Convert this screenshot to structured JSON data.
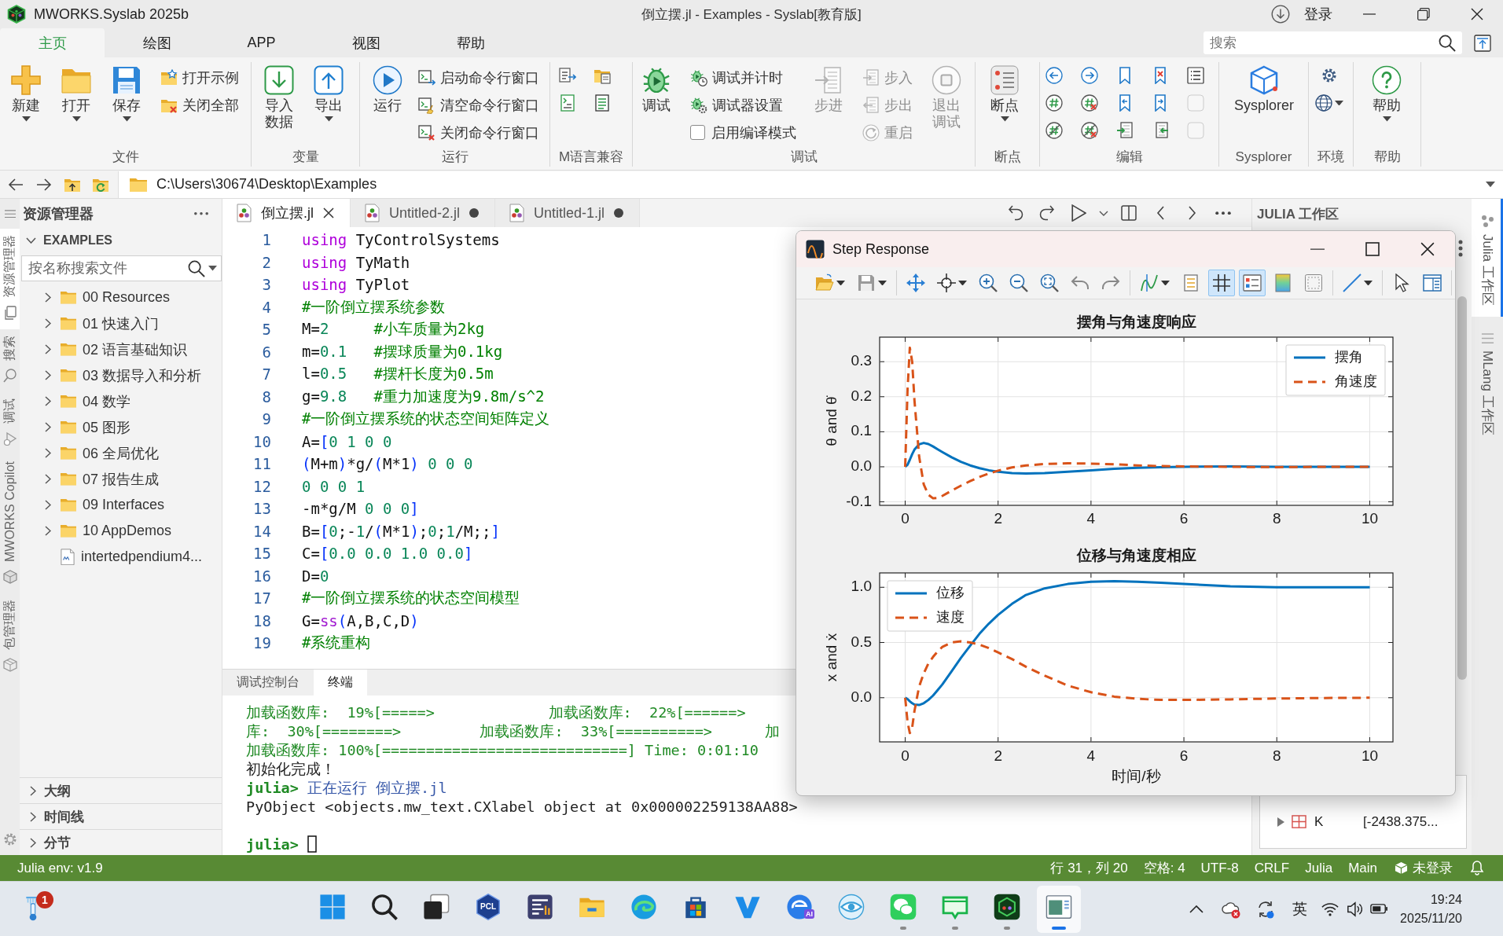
{
  "title_bar": {
    "app_name": "MWORKS.Syslab 2025b",
    "title": "倒立摆.jl - Examples - Syslab[教育版]",
    "login": "登录"
  },
  "ribbon": {
    "tabs": [
      {
        "label": "主页",
        "selected": true
      },
      {
        "label": "绘图",
        "selected": false
      },
      {
        "label": "APP",
        "selected": false
      },
      {
        "label": "视图",
        "selected": false
      },
      {
        "label": "帮助",
        "selected": false
      }
    ],
    "search": {
      "placeholder": "搜索"
    },
    "groups": [
      {
        "columns": [
          {
            "kind": "large",
            "label": "新建",
            "dropdown": true,
            "disabled": false
          },
          {
            "kind": "large",
            "label": "打开",
            "dropdown": true,
            "disabled": false
          },
          {
            "kind": "large",
            "label": "保存",
            "dropdown": true,
            "disabled": false
          },
          {
            "kind": "stack",
            "items": [
              {
                "kind": "button",
                "label": "打开示例",
                "disabled": false
              },
              {
                "kind": "button",
                "label": "关闭全部",
                "disabled": false
              }
            ]
          }
        ],
        "label": "文件"
      },
      {
        "columns": [
          {
            "kind": "large",
            "label": "导入数据",
            "dropdown": false,
            "disabled": false
          },
          {
            "kind": "large",
            "label": "导出",
            "dropdown": true,
            "disabled": false
          }
        ],
        "label": "变量"
      },
      {
        "columns": [
          {
            "kind": "large",
            "label": "运行",
            "dropdown": false,
            "disabled": false
          },
          {
            "kind": "stack",
            "items": [
              {
                "kind": "button",
                "label": "启动命令行窗口",
                "disabled": false
              },
              {
                "kind": "button",
                "label": "清空命令行窗口",
                "disabled": false
              },
              {
                "kind": "button",
                "label": "关闭命令行窗口",
                "disabled": false
              }
            ]
          }
        ],
        "label": "运行"
      },
      {
        "columns": [
          {
            "kind": "icons",
            "items": [
              {
                "disabled": false
              },
              {
                "disabled": false
              }
            ]
          },
          {
            "kind": "icons",
            "items": [
              {
                "disabled": false
              },
              {
                "disabled": false
              }
            ]
          }
        ],
        "label": "M语言兼容"
      },
      {
        "columns": [
          {
            "kind": "large",
            "label": "调试",
            "dropdown": false,
            "disabled": false
          },
          {
            "kind": "stack",
            "items": [
              {
                "kind": "button",
                "label": "调试并计时",
                "disabled": false
              },
              {
                "kind": "button",
                "label": "调试器设置",
                "disabled": false
              },
              {
                "kind": "check",
                "label": "启用编译模式",
                "checked": false
              }
            ]
          },
          {
            "kind": "large",
            "label": "步进",
            "dropdown": false,
            "disabled": true
          },
          {
            "kind": "stack",
            "items": [
              {
                "kind": "button",
                "label": "步入",
                "disabled": true
              },
              {
                "kind": "button",
                "label": "步出",
                "disabled": true
              },
              {
                "kind": "button",
                "label": "重启",
                "disabled": true
              }
            ]
          },
          {
            "kind": "large",
            "label": "退出调试",
            "dropdown": false,
            "disabled": true
          }
        ],
        "label": "调试"
      },
      {
        "columns": [
          {
            "kind": "large",
            "label": "断点",
            "dropdown": true,
            "disabled": false
          }
        ],
        "label": "断点"
      },
      {
        "columns": [
          {
            "kind": "icons",
            "items": [
              {
                "disabled": false
              },
              {
                "disabled": false
              },
              {
                "disabled": false
              }
            ]
          },
          {
            "kind": "icons",
            "items": [
              {
                "disabled": false
              },
              {
                "disabled": false
              },
              {
                "disabled": false
              }
            ]
          },
          {
            "kind": "icons",
            "items": [
              {
                "disabled": false
              },
              {
                "disabled": false
              },
              {
                "disabled": false
              }
            ]
          },
          {
            "kind": "icons",
            "items": [
              {
                "disabled": false
              },
              {
                "disabled": false
              },
              {
                "disabled": false
              }
            ]
          },
          {
            "kind": "icons",
            "items": [
              {
                "disabled": false
              },
              {
                "disabled": true
              },
              {
                "disabled": true
              }
            ]
          }
        ],
        "label": "编辑"
      },
      {
        "columns": [
          {
            "kind": "large",
            "label": "Sysplorer",
            "dropdown": false,
            "disabled": false
          }
        ],
        "label": "Sysplorer"
      },
      {
        "columns": [
          {
            "kind": "icons",
            "items": [
              {
                "disabled": false,
                "dropdown": false
              },
              {
                "disabled": false,
                "dropdown": true
              }
            ]
          }
        ],
        "label": "环境"
      },
      {
        "columns": [
          {
            "kind": "large",
            "label": "帮助",
            "dropdown": true,
            "disabled": false
          }
        ],
        "label": "帮助"
      }
    ]
  },
  "address_bar": {
    "path": "C:\\Users\\30674\\Desktop\\Examples"
  },
  "activity_bar": [
    {
      "label": "资源管理器",
      "selected": true
    },
    {
      "label": "搜索",
      "selected": false
    },
    {
      "label": "调试",
      "selected": false
    },
    {
      "label": "MWORKS Copilot",
      "selected": false
    },
    {
      "label": "包管理器",
      "selected": false
    }
  ],
  "explorer": {
    "title": "资源管理器",
    "section": {
      "label": "EXAMPLES",
      "expanded": true
    },
    "search": {
      "placeholder": "按名称搜索文件"
    },
    "items": [
      {
        "kind": "folder",
        "label": "00 Resources",
        "expanded": false
      },
      {
        "kind": "folder",
        "label": "01 快速入门",
        "expanded": false
      },
      {
        "kind": "folder",
        "label": "02 语言基础知识",
        "expanded": false
      },
      {
        "kind": "folder",
        "label": "03 数据导入和分析",
        "expanded": false
      },
      {
        "kind": "folder",
        "label": "04 数学",
        "expanded": false
      },
      {
        "kind": "folder",
        "label": "05 图形",
        "expanded": false
      },
      {
        "kind": "folder",
        "label": "06 全局优化",
        "expanded": false
      },
      {
        "kind": "folder",
        "label": "07 报告生成",
        "expanded": false
      },
      {
        "kind": "folder",
        "label": "09 Interfaces",
        "expanded": false
      },
      {
        "kind": "folder",
        "label": "10 AppDemos",
        "expanded": false
      },
      {
        "kind": "file",
        "label": "intertedpendium4..."
      }
    ],
    "bottom_sections": [
      {
        "label": "大纲",
        "expanded": false
      },
      {
        "label": "时间线",
        "expanded": false
      },
      {
        "label": "分节",
        "expanded": false
      }
    ]
  },
  "editor": {
    "tabs": [
      {
        "label": "倒立摆.jl",
        "selected": true,
        "modified": false
      },
      {
        "label": "Untitled-2.jl",
        "selected": false,
        "modified": true
      },
      {
        "label": "Untitled-1.jl",
        "selected": false,
        "modified": true
      }
    ],
    "lines": [
      {
        "number": "1",
        "tokens": [
          {
            "kind": "keyword",
            "text": "using"
          },
          {
            "kind": "plain",
            "text": " TyControlSystems"
          }
        ]
      },
      {
        "number": "2",
        "tokens": [
          {
            "kind": "keyword",
            "text": "using"
          },
          {
            "kind": "plain",
            "text": " TyMath"
          }
        ]
      },
      {
        "number": "3",
        "tokens": [
          {
            "kind": "keyword",
            "text": "using"
          },
          {
            "kind": "plain",
            "text": " TyPlot"
          }
        ]
      },
      {
        "number": "4",
        "comment": "#一阶倒立摆系统参数"
      },
      {
        "number": "5",
        "tokens": [
          {
            "kind": "plain",
            "text": "M="
          },
          {
            "kind": "number",
            "text": "2"
          }
        ],
        "comment": "#小车质量为2kg"
      },
      {
        "number": "6",
        "tokens": [
          {
            "kind": "plain",
            "text": "m="
          },
          {
            "kind": "number",
            "text": "0.1"
          }
        ],
        "comment": "#摆球质量为0.1kg"
      },
      {
        "number": "7",
        "tokens": [
          {
            "kind": "plain",
            "text": "l="
          },
          {
            "kind": "number",
            "text": "0.5"
          }
        ],
        "comment": "#摆杆长度为0.5m"
      },
      {
        "number": "8",
        "tokens": [
          {
            "kind": "plain",
            "text": "g="
          },
          {
            "kind": "number",
            "text": "9.8"
          }
        ],
        "comment": "#重力加速度为9.8m/s^2"
      },
      {
        "number": "9",
        "comment": "#一阶倒立摆系统的状态空间矩阵定义"
      },
      {
        "number": "10",
        "tokens": [
          {
            "kind": "plain",
            "text": "A="
          },
          {
            "kind": "bracket",
            "text": "["
          },
          {
            "kind": "number",
            "text": "0 1 0 0"
          }
        ]
      },
      {
        "number": "11",
        "tokens": [
          {
            "kind": "bracket",
            "text": "("
          },
          {
            "kind": "plain",
            "text": "M+m"
          },
          {
            "kind": "bracket",
            "text": ")"
          },
          {
            "kind": "plain",
            "text": "*g/"
          },
          {
            "kind": "bracket",
            "text": "("
          },
          {
            "kind": "plain",
            "text": "M*1"
          },
          {
            "kind": "bracket",
            "text": ") "
          },
          {
            "kind": "number",
            "text": "0 0 0"
          }
        ]
      },
      {
        "number": "12",
        "tokens": [
          {
            "kind": "number",
            "text": "0 0 0 1"
          }
        ]
      },
      {
        "number": "13",
        "tokens": [
          {
            "kind": "plain",
            "text": "-m*g/M "
          },
          {
            "kind": "number",
            "text": "0 0 0"
          },
          {
            "kind": "bracket",
            "text": "]"
          }
        ]
      },
      {
        "number": "14",
        "tokens": [
          {
            "kind": "plain",
            "text": "B="
          },
          {
            "kind": "bracket",
            "text": "["
          },
          {
            "kind": "number",
            "text": "0"
          },
          {
            "kind": "plain",
            "text": ";-"
          },
          {
            "kind": "number",
            "text": "1"
          },
          {
            "kind": "plain",
            "text": "/"
          },
          {
            "kind": "bracket",
            "text": "("
          },
          {
            "kind": "plain",
            "text": "M*1"
          },
          {
            "kind": "bracket",
            "text": ")"
          },
          {
            "kind": "plain",
            "text": ";"
          },
          {
            "kind": "number",
            "text": "0"
          },
          {
            "kind": "plain",
            "text": ";"
          },
          {
            "kind": "number",
            "text": "1"
          },
          {
            "kind": "plain",
            "text": "/M;;"
          },
          {
            "kind": "bracket",
            "text": "]"
          }
        ]
      },
      {
        "number": "15",
        "tokens": [
          {
            "kind": "plain",
            "text": "C="
          },
          {
            "kind": "bracket",
            "text": "["
          },
          {
            "kind": "number",
            "text": "0.0 0.0 1.0 0.0"
          },
          {
            "kind": "bracket",
            "text": "]"
          }
        ]
      },
      {
        "number": "16",
        "tokens": [
          {
            "kind": "plain",
            "text": "D="
          },
          {
            "kind": "number",
            "text": "0"
          }
        ]
      },
      {
        "number": "17",
        "comment": "#一阶倒立摆系统的状态空间模型"
      },
      {
        "number": "18",
        "tokens": [
          {
            "kind": "plain",
            "text": "G="
          },
          {
            "kind": "call",
            "text": "ss"
          },
          {
            "kind": "bracket",
            "text": "("
          },
          {
            "kind": "plain",
            "text": "A,B,C,D"
          },
          {
            "kind": "bracket",
            "text": ")"
          }
        ]
      },
      {
        "number": "19",
        "comment": "#系统重构"
      }
    ]
  },
  "panel": {
    "tabs": [
      {
        "label": "调试控制台",
        "selected": false
      },
      {
        "label": "终端",
        "selected": true
      }
    ],
    "lines": [
      {
        "kind": "progress",
        "text": "加载函数库:  19%[=====>             加载函数库:  22%[======>"
      },
      {
        "kind": "progress",
        "text": "库:  30%[========>         加载函数库:  33%[==========>      加"
      },
      {
        "kind": "progress",
        "text": "加载函数库: 100%[============================] Time: 0:01:10"
      },
      {
        "kind": "output",
        "text": "初始化完成！"
      },
      {
        "kind": "prompt",
        "prompt": "julia>",
        "text": "正在运行 倒立摆.jl"
      },
      {
        "kind": "output",
        "text": "PyObject <objects.mw_text.CXlabel object at 0x000002259138AA88>"
      },
      {
        "kind": "blank"
      },
      {
        "kind": "input",
        "prompt": "julia>"
      }
    ]
  },
  "workspace": {
    "title": "JULIA 工作区",
    "rows": [
      {
        "name": "K",
        "value": "[-2438.375...",
        "expanded": false
      }
    ]
  },
  "right_bar": [
    {
      "label": "Julia 工作区",
      "selected": true
    },
    {
      "label": "MLang 工作区",
      "selected": false
    }
  ],
  "plot_window": {
    "title": "Step Response",
    "toolbar": [
      {
        "buttons": [
          {
            "on": false,
            "dropdown": true
          },
          {
            "on": false,
            "dropdown": true
          }
        ]
      },
      {
        "buttons": [
          {
            "on": false,
            "dropdown": false
          },
          {
            "on": false,
            "dropdown": true
          },
          {
            "on": false,
            "dropdown": false
          },
          {
            "on": false,
            "dropdown": false
          },
          {
            "on": false,
            "dropdown": false
          },
          {
            "on": false,
            "dropdown": false
          },
          {
            "on": false,
            "dropdown": false
          }
        ]
      },
      {
        "buttons": [
          {
            "on": false,
            "dropdown": true
          },
          {
            "on": false,
            "dropdown": false
          },
          {
            "on": true,
            "dropdown": false
          },
          {
            "on": true,
            "dropdown": false
          },
          {
            "on": false,
            "dropdown": false
          },
          {
            "on": false,
            "dropdown": false
          }
        ]
      },
      {
        "buttons": [
          {
            "on": false,
            "dropdown": true
          }
        ]
      },
      {
        "buttons": [
          {
            "on": false,
            "dropdown": false
          },
          {
            "on": false,
            "dropdown": false
          }
        ]
      }
    ],
    "charts": [
      {
        "chart_data": {
          "type": "line",
          "title": "摆角与角速度响应",
          "ylabel": "θ and θ̇",
          "x": [
            0,
            0.05,
            0.1,
            0.15,
            0.2,
            0.3,
            0.4,
            0.5,
            0.6,
            0.7,
            0.8,
            1,
            1.2,
            1.4,
            1.6,
            1.8,
            2,
            2.3,
            2.6,
            3,
            3.5,
            4,
            4.5,
            5,
            5.5,
            6,
            7,
            8,
            9,
            10
          ],
          "xlim": [
            -0.55,
            10.5
          ],
          "ylim": [
            -0.11,
            0.37
          ],
          "xticks": [
            {
              "value": 0,
              "label": "0"
            },
            {
              "value": 2,
              "label": "2"
            },
            {
              "value": 4,
              "label": "4"
            },
            {
              "value": 6,
              "label": "6"
            },
            {
              "value": 8,
              "label": "8"
            },
            {
              "value": 10,
              "label": "10"
            }
          ],
          "yticks": [
            {
              "value": -0.1,
              "label": "-0.1"
            },
            {
              "value": 0,
              "label": "0.0"
            },
            {
              "value": 0.1,
              "label": "0.1"
            },
            {
              "value": 0.2,
              "label": "0.2"
            },
            {
              "value": 0.3,
              "label": "0.3"
            }
          ],
          "grid": true,
          "legend": "upper right",
          "series": [
            {
              "name": "摆角",
              "color": "#0072bd",
              "line_style": "solid",
              "values": [
                0,
                0.006,
                0.02,
                0.036,
                0.049,
                0.064,
                0.068,
                0.065,
                0.058,
                0.05,
                0.042,
                0.027,
                0.014,
                0.004,
                -0.004,
                -0.01,
                -0.014,
                -0.018,
                -0.019,
                -0.018,
                -0.014,
                -0.01,
                -0.006,
                -0.003,
                -0.001,
                0,
                0.001,
                0,
                0,
                0
              ]
            },
            {
              "name": "角速度",
              "color": "#d95319",
              "line_style": "dashed",
              "values": [
                0,
                0.22,
                0.34,
                0.3,
                0.19,
                0.03,
                -0.05,
                -0.08,
                -0.09,
                -0.089,
                -0.083,
                -0.068,
                -0.054,
                -0.041,
                -0.029,
                -0.019,
                -0.011,
                -0.002,
                0.004,
                0.008,
                0.01,
                0.009,
                0.007,
                0.004,
                0.002,
                0.001,
                0,
                -0.001,
                0,
                0
              ]
            }
          ]
        }
      },
      {
        "chart_data": {
          "type": "line",
          "title": "位移与角速度相应",
          "xlabel": "时间/秒",
          "ylabel": "x and ẋ",
          "x": [
            0,
            0.05,
            0.1,
            0.15,
            0.2,
            0.3,
            0.4,
            0.5,
            0.6,
            0.7,
            0.8,
            1,
            1.2,
            1.4,
            1.6,
            1.8,
            2,
            2.3,
            2.6,
            3,
            3.5,
            4,
            4.5,
            5,
            5.5,
            6,
            7,
            8,
            9,
            10
          ],
          "xlim": [
            -0.55,
            10.5
          ],
          "ylim": [
            -0.4,
            1.13
          ],
          "xticks": [
            {
              "value": 0,
              "label": "0"
            },
            {
              "value": 2,
              "label": "2"
            },
            {
              "value": 4,
              "label": "4"
            },
            {
              "value": 6,
              "label": "6"
            },
            {
              "value": 8,
              "label": "8"
            },
            {
              "value": 10,
              "label": "10"
            }
          ],
          "yticks": [
            {
              "value": 0,
              "label": "0.0"
            },
            {
              "value": 0.5,
              "label": "0.5"
            },
            {
              "value": 1,
              "label": "1.0"
            }
          ],
          "grid": true,
          "legend": "upper left",
          "series": [
            {
              "name": "位移",
              "color": "#0072bd",
              "line_style": "solid",
              "values": [
                0,
                -0.012,
                -0.032,
                -0.05,
                -0.062,
                -0.066,
                -0.05,
                -0.02,
                0.02,
                0.07,
                0.12,
                0.24,
                0.36,
                0.47,
                0.58,
                0.67,
                0.75,
                0.85,
                0.93,
                0.99,
                1.03,
                1.05,
                1.055,
                1.05,
                1.04,
                1.03,
                1.01,
                1,
                1,
                1
              ]
            },
            {
              "name": "速度",
              "color": "#d95319",
              "line_style": "dashed",
              "values": [
                0,
                -0.22,
                -0.32,
                -0.27,
                -0.12,
                0.1,
                0.22,
                0.31,
                0.37,
                0.42,
                0.46,
                0.5,
                0.51,
                0.5,
                0.48,
                0.45,
                0.41,
                0.35,
                0.28,
                0.2,
                0.11,
                0.05,
                0.01,
                -0.01,
                -0.02,
                -0.02,
                -0.015,
                -0.007,
                -0.003,
                0
              ]
            }
          ]
        }
      }
    ]
  },
  "status_bar": {
    "env": "Julia env: v1.9",
    "items": [
      "行 31，列 20",
      "空格: 4",
      "UTF-8",
      "CRLF",
      "Julia",
      "Main"
    ],
    "account": "未登录"
  },
  "taskbar": {
    "weather_badge": "1",
    "apps": [
      {
        "running": false,
        "active": false
      },
      {
        "running": false,
        "active": false
      },
      {
        "running": false,
        "active": false
      },
      {
        "running": false,
        "active": false,
        "label": "PCL"
      },
      {
        "running": false,
        "active": false
      },
      {
        "running": false,
        "active": false
      },
      {
        "running": false,
        "active": false
      },
      {
        "running": false,
        "active": false
      },
      {
        "running": false,
        "active": false
      },
      {
        "running": false,
        "active": false,
        "label": "AI"
      },
      {
        "running": false,
        "active": false
      },
      {
        "running": true,
        "active": false
      },
      {
        "running": true,
        "active": false
      },
      {
        "running": true,
        "active": false
      },
      {
        "running": true,
        "active": true
      }
    ],
    "input_method": "英",
    "time": "19:24",
    "date": "2025/11/20"
  }
}
